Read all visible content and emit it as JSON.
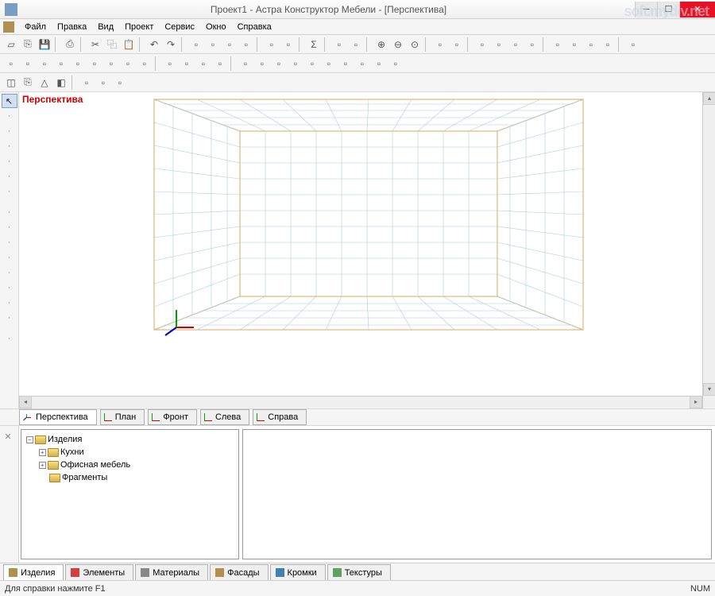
{
  "window": {
    "title": "Проект1 - Астра Конструктор Мебели - [Перспектива]",
    "watermark": "soft.mydiv.net"
  },
  "menu": {
    "items": [
      "Файл",
      "Правка",
      "Вид",
      "Проект",
      "Сервис",
      "Окно",
      "Справка"
    ]
  },
  "viewport": {
    "label": "Перспектива"
  },
  "viewtabs": {
    "items": [
      "Перспектива",
      "План",
      "Фронт",
      "Слева",
      "Справа"
    ],
    "active": 0
  },
  "tree": {
    "root": "Изделия",
    "children": [
      {
        "label": "Кухни",
        "expandable": true
      },
      {
        "label": "Офисная мебель",
        "expandable": true
      },
      {
        "label": "Фрагменты",
        "expandable": false
      }
    ]
  },
  "bottomtabs": {
    "items": [
      "Изделия",
      "Элементы",
      "Материалы",
      "Фасады",
      "Кромки",
      "Текстуры"
    ],
    "active": 0
  },
  "statusbar": {
    "hint": "Для справки нажмите F1",
    "num": "NUM"
  },
  "toolbar1_icons": [
    "new",
    "open",
    "save",
    "sep",
    "print",
    "sep",
    "cut",
    "copy",
    "paste",
    "sep",
    "undo",
    "redo",
    "sep",
    "t1",
    "t2",
    "t3",
    "t4",
    "sep",
    "t5",
    "t6",
    "sep",
    "sigma",
    "sep",
    "t7",
    "t8",
    "sep",
    "zoomin",
    "zoomout",
    "zoomfit",
    "sep",
    "t9",
    "t10",
    "sep",
    "cube1",
    "cube2",
    "cube3",
    "cube4",
    "sep",
    "c5",
    "c6",
    "c7",
    "c8",
    "sep",
    "c9"
  ],
  "toolbar2_icons": [
    "a1",
    "a2",
    "a3",
    "a4",
    "a5",
    "a6",
    "a7",
    "a8",
    "a9",
    "sep",
    "b1",
    "b2",
    "b3",
    "b4",
    "sep",
    "c1",
    "c2",
    "c3",
    "c4",
    "c5",
    "c6",
    "c7",
    "c8",
    "c9",
    "c10"
  ],
  "toolbar3_icons": [
    "box",
    "open",
    "tri",
    "mirror",
    "sep",
    "p1",
    "p2",
    "p3"
  ],
  "lefttool_icons": [
    "arrow",
    "l1",
    "l2",
    "l3",
    "l4",
    "l5",
    "l6",
    "sep",
    "l7",
    "l8",
    "l9",
    "l10",
    "l11",
    "l12",
    "l13",
    "l14",
    "sep",
    "l15"
  ]
}
